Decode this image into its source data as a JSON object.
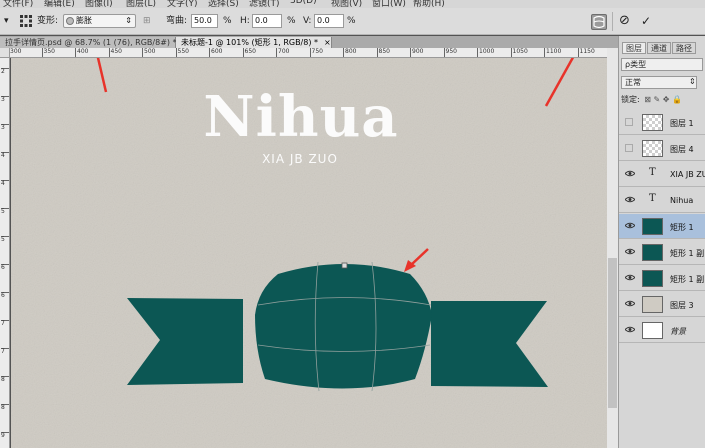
{
  "app": {
    "menu": [
      "文件(F)",
      "编辑(E)",
      "图像(I)",
      "图层(L)",
      "文字(Y)",
      "选择(S)",
      "滤镜(T)",
      "3D(D)",
      "视图(V)",
      "窗口(W)",
      "帮助(H)"
    ]
  },
  "options": {
    "warp_label": "变形:",
    "warp_value": "膨胀",
    "bend_label": "弯曲:",
    "bend_value": "50.0",
    "h_label": "H:",
    "h_value": "0.0",
    "v_label": "V:",
    "v_value": "0.0",
    "percent": "%",
    "cancel_icon": "⊘",
    "commit_icon": "✓"
  },
  "tabs": [
    {
      "label": "拉手详情页.psd @ 68.7% (1 (76), RGB/8#) *",
      "close": "×"
    },
    {
      "label": "未标题-1 @ 101% (矩形 1, RGB/8) *",
      "close": "×"
    }
  ],
  "ruler": {
    "h_ticks": [
      "300",
      "350",
      "400",
      "450",
      "500",
      "550",
      "600",
      "650",
      "700",
      "750",
      "800",
      "850",
      "900",
      "950",
      "1000",
      "1050",
      "1100",
      "1150"
    ],
    "v_ticks": [
      "2",
      "3",
      "3",
      "4",
      "4",
      "5",
      "5",
      "6",
      "6",
      "7",
      "7",
      "8",
      "8",
      "9"
    ]
  },
  "canvas": {
    "headline": "Nihua",
    "subhead": "XIA JB ZUO",
    "ribbon_color": "#0c5754",
    "background_color": "#cfcbc3"
  },
  "panel": {
    "tabs": [
      "图层",
      "通道",
      "路径"
    ],
    "filter_label": "ρ类型",
    "blend_mode": "正常",
    "lock_label": "锁定:",
    "layers": [
      {
        "name": "图层 1",
        "type": "raster",
        "visible": false,
        "selected": false
      },
      {
        "name": "图层 4",
        "type": "raster",
        "visible": false,
        "selected": false
      },
      {
        "name": "XIA JB ZUO",
        "type": "text",
        "visible": true,
        "selected": false
      },
      {
        "name": "Nihua",
        "type": "text",
        "visible": true,
        "selected": false
      },
      {
        "name": "矩形 1",
        "type": "shape",
        "visible": true,
        "selected": true
      },
      {
        "name": "矩形 1 副",
        "type": "shape",
        "visible": true,
        "selected": false
      },
      {
        "name": "矩形 1 副",
        "type": "shape",
        "visible": true,
        "selected": false
      },
      {
        "name": "图层 3",
        "type": "fill",
        "visible": true,
        "selected": false
      },
      {
        "name": "背景",
        "type": "background",
        "visible": true,
        "selected": false
      }
    ]
  }
}
